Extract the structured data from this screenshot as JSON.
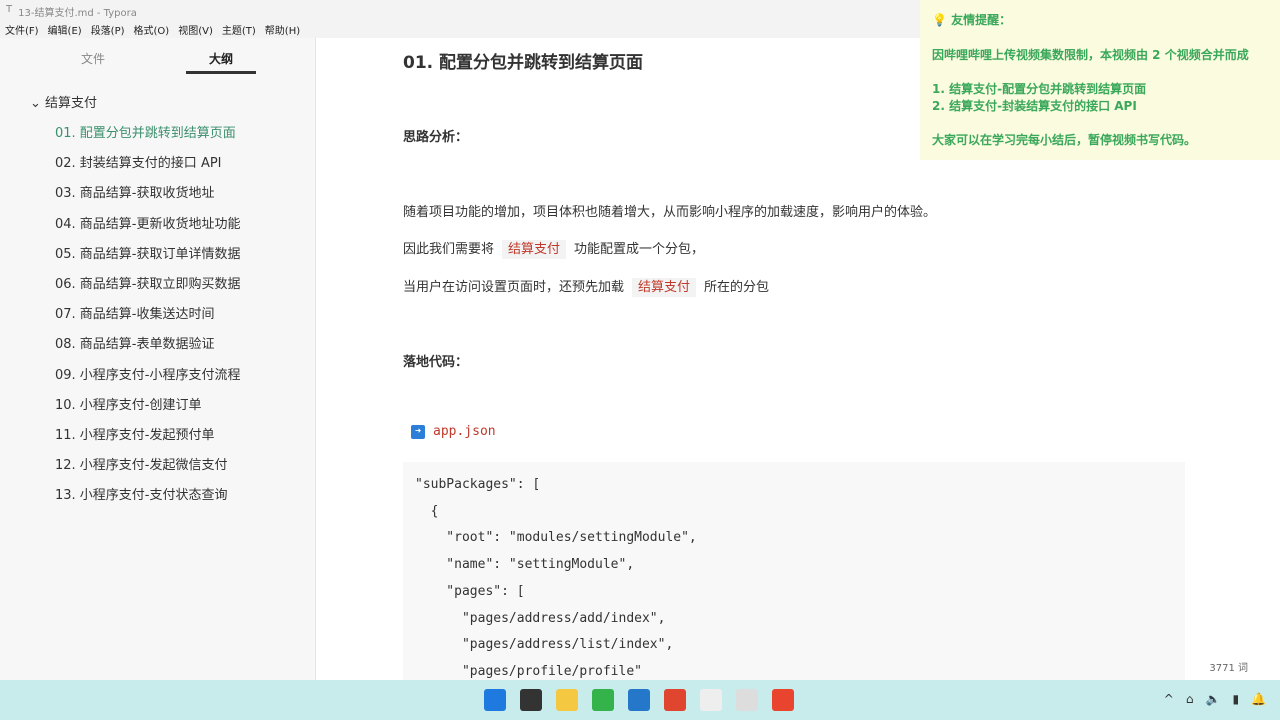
{
  "window": {
    "title": "13-结算支付.md - Typora"
  },
  "menu": [
    "文件(F)",
    "编辑(E)",
    "段落(P)",
    "格式(O)",
    "视图(V)",
    "主题(T)",
    "帮助(H)"
  ],
  "sidebar": {
    "tabs": [
      "文件",
      "大纲"
    ],
    "root": "结算支付",
    "items": [
      "01. 配置分包并跳转到结算页面",
      "02. 封装结算支付的接口 API",
      "03. 商品结算-获取收货地址",
      "04. 商品结算-更新收货地址功能",
      "05. 商品结算-获取订单详情数据",
      "06. 商品结算-获取立即购买数据",
      "07. 商品结算-收集送达时间",
      "08. 商品结算-表单数据验证",
      "09. 小程序支付-小程序支付流程",
      "10. 小程序支付-创建订单",
      "11. 小程序支付-发起预付单",
      "12. 小程序支付-发起微信支付",
      "13. 小程序支付-支付状态查询"
    ],
    "footer": {
      "back": "‹",
      "source": "</>"
    }
  },
  "doc": {
    "title": "01. 配置分包并跳转到结算页面",
    "analysis": "思路分析：",
    "p1": "随着项目功能的增加，项目体积也随着增大，从而影响小程序的加载速度，影响用户的体验。",
    "p2a": "因此我们需要将",
    "p2code": "结算支付",
    "p2b": "功能配置成一个分包，",
    "p3a": "当用户在访问设置页面时，还预先加载",
    "p3code": "结算支付",
    "p3b": "所在的分包",
    "landing": "落地代码：",
    "file": "app.json",
    "code": "\"subPackages\": [\n  {\n    \"root\": \"modules/settingModule\",\n    \"name\": \"settingModule\",\n    \"pages\": [\n      \"pages/address/add/index\",\n      \"pages/address/list/index\",\n      \"pages/profile/profile\""
  },
  "word_count": "3771 词",
  "notice": {
    "title": "友情提醒：",
    "line1": "因哔哩哔哩上传视频集数限制，本视频由 2 个视频合并而成",
    "item1": "1. 结算支付-配置分包并跳转到结算页面",
    "item2": "2. 结算支付-封装结算支付的接口 API",
    "tip": "大家可以在学习完每小结后，暂停视频书写代码。"
  },
  "taskbar": {
    "apps": [
      "start",
      "search",
      "explorer",
      "wechat-dev",
      "vscode",
      "chrome",
      "typora",
      "app",
      "recorder"
    ],
    "colors": [
      "#1f7ae0",
      "#333333",
      "#f5c842",
      "#34b34a",
      "#2477c9",
      "#e0462f",
      "#eeeeee",
      "#dddddd",
      "#e8442e"
    ]
  }
}
